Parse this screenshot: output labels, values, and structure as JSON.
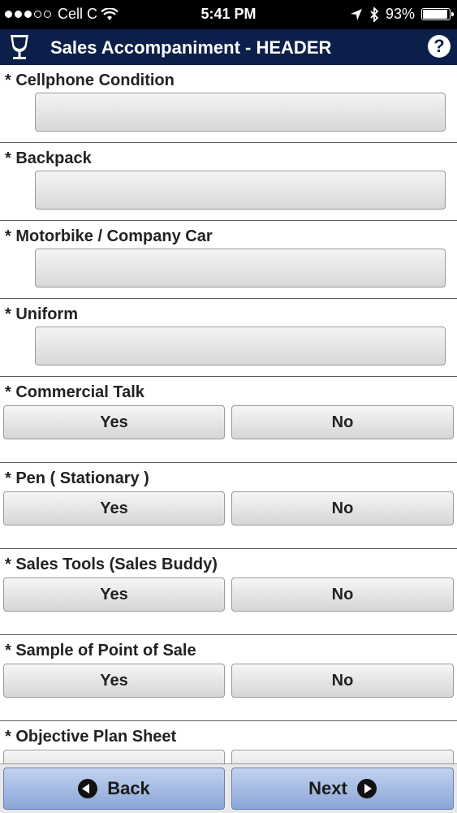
{
  "status_bar": {
    "carrier": "Cell C",
    "time": "5:41 PM",
    "battery": "93%",
    "battery_level": 0.93
  },
  "header": {
    "title": "Sales Accompaniment - HEADER",
    "help_label": "?"
  },
  "form": {
    "fields": [
      {
        "label": "* Cellphone Condition",
        "type": "input"
      },
      {
        "label": "* Backpack",
        "type": "input"
      },
      {
        "label": "* Motorbike / Company Car",
        "type": "input"
      },
      {
        "label": "* Uniform",
        "type": "input"
      },
      {
        "label": "* Commercial Talk",
        "type": "yesno",
        "yes": "Yes",
        "no": "No"
      },
      {
        "label": "* Pen ( Stationary )",
        "type": "yesno",
        "yes": "Yes",
        "no": "No"
      },
      {
        "label": "* Sales Tools (Sales Buddy)",
        "type": "yesno",
        "yes": "Yes",
        "no": "No"
      },
      {
        "label": "* Sample of Point of Sale",
        "type": "yesno",
        "yes": "Yes",
        "no": "No"
      },
      {
        "label": "* Objective Plan Sheet",
        "type": "yesno",
        "yes": "",
        "no": ""
      }
    ]
  },
  "footer": {
    "back_label": "Back",
    "next_label": "Next"
  }
}
